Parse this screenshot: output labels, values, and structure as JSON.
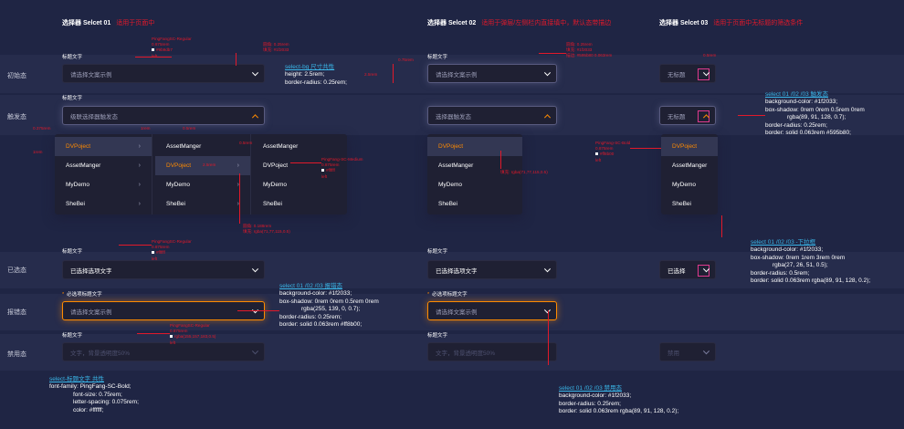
{
  "columns": [
    {
      "title": "选择器 Selcet 01",
      "desc": "适用于页面中"
    },
    {
      "title": "选择器 Selcet 02",
      "desc": "适用于弹层/左侧栏内直接填中，默认态带描边"
    },
    {
      "title": "选择器 Selcet 03",
      "desc": "适用于页面中无标题的筛选条件"
    }
  ],
  "states": [
    "初始态",
    "触发态",
    "已选态",
    "报错态",
    "禁用态"
  ],
  "label_title": "标题文字",
  "label_required": "必选项标题文字",
  "required_mark": "*",
  "placeholder": "请选择文案示例",
  "cascade_trigger": "级联选择器触发态",
  "trigger_text": "选择器触发态",
  "no_title": "无标题",
  "selected_text": "已选择选项文字",
  "selected_short": "已选择",
  "disabled_text": "文字，背景透明度50%",
  "disabled_short": "禁用",
  "menu1": [
    "DVPoject",
    "AssetManger",
    "MyDemo",
    "SheBei"
  ],
  "menu2": [
    "AssetManger",
    "DVPoject",
    "MyDemo",
    "SheBei"
  ],
  "menu3": [
    "AssetManger",
    "DVPoject",
    "MyDemo",
    "SheBei"
  ],
  "menu_arrow": "›",
  "ann": {
    "font1": "PingFangSC-Regular",
    "size1": "0.875rem",
    "color1": "#9b9db7",
    "left1": "left",
    "rad1a": "圆角: 0.25rem",
    "fill1a": "填充: #1f2033",
    "rad2": "圆角: 0.25rem",
    "fill2": "填充: #1f2033",
    "stroke2": "描边: #595b80 0.063rem",
    "w05": "0.5rem",
    "w075": "0.75rem",
    "w25": "2.5rem",
    "w1": "1rem",
    "w05b": "0.5rem",
    "mid_font": "PingFang-SC-Medium",
    "mid_size": "0.875rem",
    "mid_color": "#ffffff",
    "mid_left": "left",
    "w1b": "1rem",
    "w2": "2.5rem",
    "w3": "0.375rem",
    "rad3": "圆角: 0.188rem",
    "fill3": "填充: rgba(71,77,115,0.5)",
    "fill4": "填充: rgba(71,77,115,0.5)",
    "bold_font": "PingFang-SC-Bold",
    "bold_size": "0.875rem",
    "bold_color": "#ff8b00",
    "bold_left": "left",
    "sel_font": "PingFangSC-Regular",
    "sel_size": "0.875rem",
    "sel_color": "#ffffff",
    "sel_left": "left",
    "dis_font": "PingFangSC-Regular",
    "dis_size": "0.875rem",
    "dis_color": "rgba(155,157,183,0.5)",
    "dis_left": "left",
    "w05c": "0.5rem",
    "w2b": "0.5rem"
  },
  "notes": {
    "size_title": "select-bg 尺寸共性",
    "size_lines": [
      "height: 2.5rem;",
      "border-radius: 0.25rem;"
    ],
    "trig_title": "select 01 /02 /03 触发态",
    "trig_lines": [
      "background-color: #1f2033;",
      "box-shadow: 0rem 0rem 0.5rem 0rem",
      "rgba(89, 91, 128, 0.7);",
      "border-radius: 0.25rem;",
      "border: solid 0.063rem #595b80;"
    ],
    "dd_title": "select 01 /02 /03 -下拉框",
    "dd_lines": [
      "background-color: #1f2033;",
      "box-shadow: 0rem 1rem 3rem 0rem",
      "rgba(27, 26, 51, 0.5);",
      "border-radius: 0.5rem;",
      "border: solid 0.063rem rgba(89, 91, 128, 0.2);"
    ],
    "err_title": "select 01 /02 /03 报错态",
    "err_lines": [
      "background-color: #1f2033;",
      "box-shadow: 0rem 0rem 0.5rem 0rem",
      "rgba(255, 139, 0, 0.7);",
      "border-radius: 0.25rem;",
      "border: solid 0.063rem #ff8b00;"
    ],
    "lbl_title": "select-标题文字 共性",
    "lbl_lines": [
      "font-family: PingFang-SC-Bold;",
      "font-size: 0.75rem;",
      "letter-spacing: 0.075rem;",
      "color: #ffffff;"
    ],
    "dis_title": "select 01 /02 /03 禁用态",
    "dis_lines": [
      "background-color: #1f2033;",
      "border-radius: 0.25rem;",
      "border: solid 0.063rem rgba(89, 91, 128, 0.2);"
    ]
  }
}
